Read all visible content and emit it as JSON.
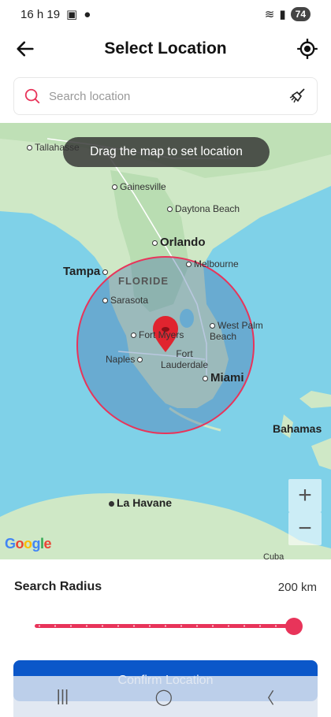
{
  "status_bar": {
    "time": "16 h 19",
    "battery": "74"
  },
  "header": {
    "title": "Select Location"
  },
  "search": {
    "placeholder": "Search location"
  },
  "map": {
    "toast": "Drag the map to set location",
    "labels": {
      "tallahassee": "Tallahasse",
      "gainesville": "Gainesville",
      "daytona": "Daytona Beach",
      "orlando": "Orlando",
      "tampa": "Tampa",
      "melbourne": "Melbourne",
      "floride": "FLORIDE",
      "sarasota": "Sarasota",
      "fort_myers": "Fort Myers",
      "west_palm": "West Palm Beach",
      "naples": "Naples",
      "fort_lauderdale": "Fort Lauderdale",
      "miami": "Miami",
      "bahamas": "Bahamas",
      "havane": "La Havane",
      "cuba": "Cuba"
    },
    "zoom_in": "+",
    "zoom_out": "−",
    "attribution": "Google",
    "accent_color": "#e8345a"
  },
  "radius": {
    "label": "Search Radius",
    "value": "200 km",
    "fraction": 1.0
  },
  "confirm_button": {
    "label": "Confirm Location"
  }
}
